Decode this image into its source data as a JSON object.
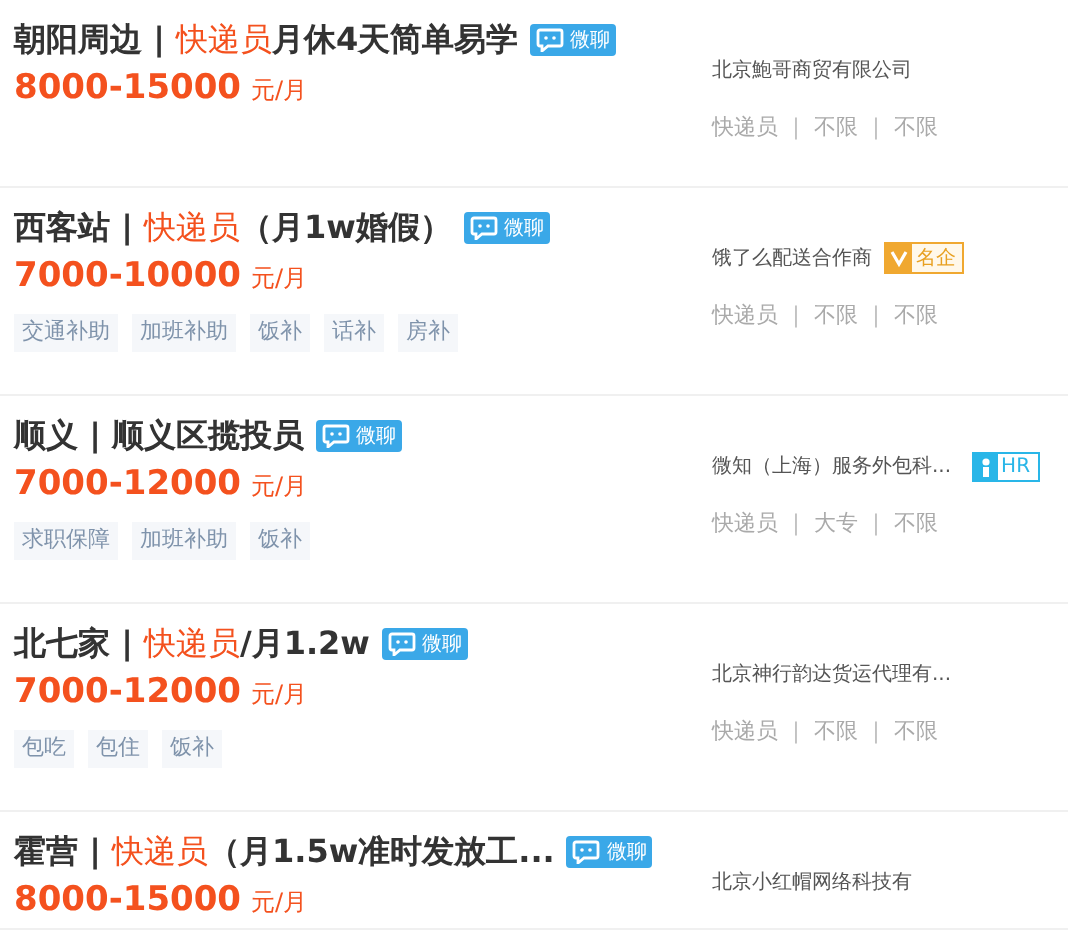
{
  "jobs": [
    {
      "title_parts": [
        {
          "text": "朝阳周边 | ",
          "highlight": false
        },
        {
          "text": "快递员",
          "highlight": true
        },
        {
          "text": "月休4天简单易学",
          "highlight": false
        }
      ],
      "chat_badge": "微聊",
      "salary": "8000-15000",
      "unit": "元/月",
      "company": "北京鮑哥商贸有限公司",
      "meta": "快递员 ｜ 不限 ｜ 不限"
    },
    {
      "title_parts": [
        {
          "text": "西客站 | ",
          "highlight": false
        },
        {
          "text": "快递员",
          "highlight": true
        },
        {
          "text": "（月1w婚假）",
          "highlight": false
        }
      ],
      "chat_badge": "微聊",
      "salary": "7000-10000",
      "unit": "元/月",
      "tags": [
        "交通补助",
        "加班补助",
        "饭补",
        "话补",
        "房补"
      ],
      "company": "饿了么配送合作商",
      "company_badge": {
        "kind": "famous",
        "label": "名企"
      },
      "meta": "快递员 ｜ 不限 ｜ 不限"
    },
    {
      "title_parts": [
        {
          "text": "顺义 | 顺义区揽投员",
          "highlight": false
        }
      ],
      "chat_badge": "微聊",
      "salary": "7000-12000",
      "unit": "元/月",
      "tags": [
        "求职保障",
        "加班补助",
        "饭补"
      ],
      "company": "微知（上海）服务外包科...",
      "company_badge": {
        "kind": "hr",
        "label": "HR"
      },
      "meta": "快递员 ｜ 大专 ｜ 不限"
    },
    {
      "title_parts": [
        {
          "text": "北七家 | ",
          "highlight": false
        },
        {
          "text": "快递员",
          "highlight": true
        },
        {
          "text": "/月1.2w",
          "highlight": false
        }
      ],
      "chat_badge": "微聊",
      "salary": "7000-12000",
      "unit": "元/月",
      "tags": [
        "包吃",
        "包住",
        "饭补"
      ],
      "company": "北京神行韵达货运代理有...",
      "meta": "快递员 ｜ 不限 ｜ 不限"
    },
    {
      "title_parts": [
        {
          "text": "霍营 | ",
          "highlight": false
        },
        {
          "text": "快递员",
          "highlight": true
        },
        {
          "text": "（月1.5w准时发放工...",
          "highlight": false
        }
      ],
      "chat_badge": "微聊",
      "salary": "8000-15000",
      "unit": "元/月",
      "company": "北京小红帽网络科技有"
    }
  ]
}
